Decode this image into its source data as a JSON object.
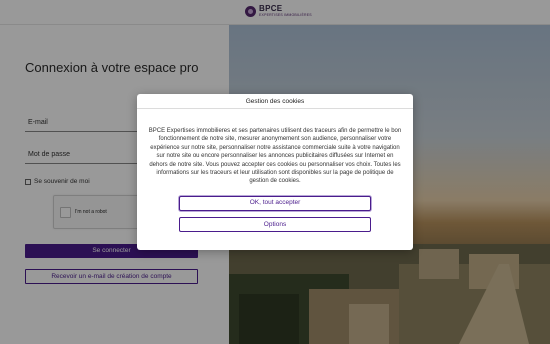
{
  "header": {
    "logo_name": "BPCE",
    "logo_sub": "EXPERTISES IMMOBILIÈRES"
  },
  "login": {
    "title": "Connexion à votre espace pro",
    "email_label": "E-mail",
    "password_label": "Mot de passe",
    "remember_label": "Se souvenir de moi",
    "captcha_label": "I'm not a robot",
    "connect_label": "Se connecter",
    "email_button_label": "Recevoir un e-mail de création de compte"
  },
  "cookies": {
    "title": "Gestion des cookies",
    "text": "BPCE Expertises immobilieres et ses partenaires utilisent des traceurs afin de permettre le bon fonctionnement de notre site, mesurer anonymement son audience, personnaliser votre expérience sur notre site, personnaliser notre assistance commerciale suite à votre navigation sur notre site ou encore personnaliser les annonces publicitaires diffusées sur Internet en dehors de notre site. Vous pouvez accepter ces cookies ou personnaliser vos choix. Toutes les informations sur les traceurs et leur utilisation sont disponibles sur la page de politique de gestion de cookies.",
    "accept_label": "OK, tout accepter",
    "options_label": "Options"
  },
  "colors": {
    "accent": "#4a1c8c",
    "brand": "#55286f"
  }
}
